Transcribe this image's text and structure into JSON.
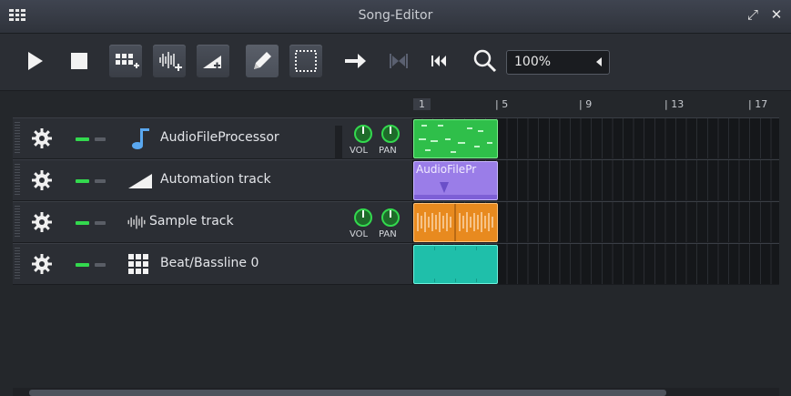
{
  "window": {
    "title": "Song-Editor"
  },
  "toolbar": {
    "play": "play-icon",
    "stop": "stop-icon",
    "add_beat": "add-beat-bassline-icon",
    "add_sample": "add-sample-track-icon",
    "add_automation": "add-automation-track-icon",
    "draw_mode": "pencil-icon",
    "select_mode": "selection-icon",
    "auto_scroll": "arrow-right-icon",
    "loop": "loop-points-icon",
    "back_to_start": "skip-back-icon",
    "zoom_icon": "magnifier-icon",
    "zoom_value": "100%"
  },
  "timeline": {
    "markers": [
      "1",
      "5",
      "9",
      "13",
      "17"
    ]
  },
  "tracks": [
    {
      "name": "AudioFileProcessor",
      "type": "instrument",
      "vol": "VOL",
      "pan": "PAN",
      "clip_color": "#2fbf4a"
    },
    {
      "name": "Automation track",
      "type": "automation",
      "clip_label": "AudioFilePr",
      "clip_color": "#9a7de8"
    },
    {
      "name": "Sample track",
      "type": "sample",
      "vol": "VOL",
      "pan": "PAN",
      "clip_color": "#e88a1f"
    },
    {
      "name": "Beat/Bassline 0",
      "type": "beat",
      "clip_color": "#1fbfaa"
    }
  ],
  "colors": {
    "accent_green": "#33d94e",
    "background": "#24272b"
  }
}
